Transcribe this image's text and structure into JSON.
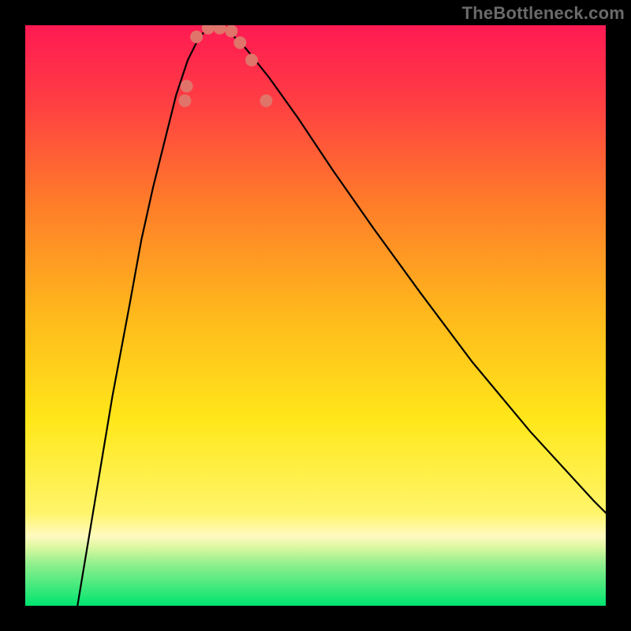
{
  "watermark": {
    "text": "TheBottleneck.com"
  },
  "chart_data": {
    "type": "line",
    "title": "",
    "xlabel": "",
    "ylabel": "",
    "xlim": [
      0,
      100
    ],
    "ylim": [
      0,
      100
    ],
    "background_gradient": {
      "top_color": "#ff1a53",
      "mid_color": "#ffe71a",
      "bottom_color": "#00e46f",
      "green_band_start_y": 88
    },
    "series": [
      {
        "name": "left-curve",
        "x": [
          9,
          12,
          15,
          18,
          20,
          22,
          24,
          25,
          26,
          27,
          28,
          29,
          30,
          31,
          32,
          33
        ],
        "y": [
          0,
          18,
          36,
          52,
          63,
          72,
          80,
          84,
          88,
          91,
          94,
          96,
          98,
          99,
          100,
          100
        ]
      },
      {
        "name": "right-curve",
        "x": [
          33,
          35,
          38,
          42,
          47,
          53,
          60,
          68,
          77,
          87,
          98,
          100
        ],
        "y": [
          100,
          99,
          96,
          91,
          84,
          75,
          65,
          54,
          42,
          30,
          18,
          16
        ]
      }
    ],
    "markers": {
      "name": "breakpoints",
      "color": "#e0746a",
      "radius": 8,
      "points": [
        {
          "x": 27.5,
          "y": 87
        },
        {
          "x": 27.8,
          "y": 89.5
        },
        {
          "x": 29.5,
          "y": 98
        },
        {
          "x": 31.5,
          "y": 99.5
        },
        {
          "x": 33.5,
          "y": 99.5
        },
        {
          "x": 35.5,
          "y": 99
        },
        {
          "x": 37.0,
          "y": 97
        },
        {
          "x": 39.0,
          "y": 94
        },
        {
          "x": 41.5,
          "y": 87
        }
      ]
    }
  }
}
